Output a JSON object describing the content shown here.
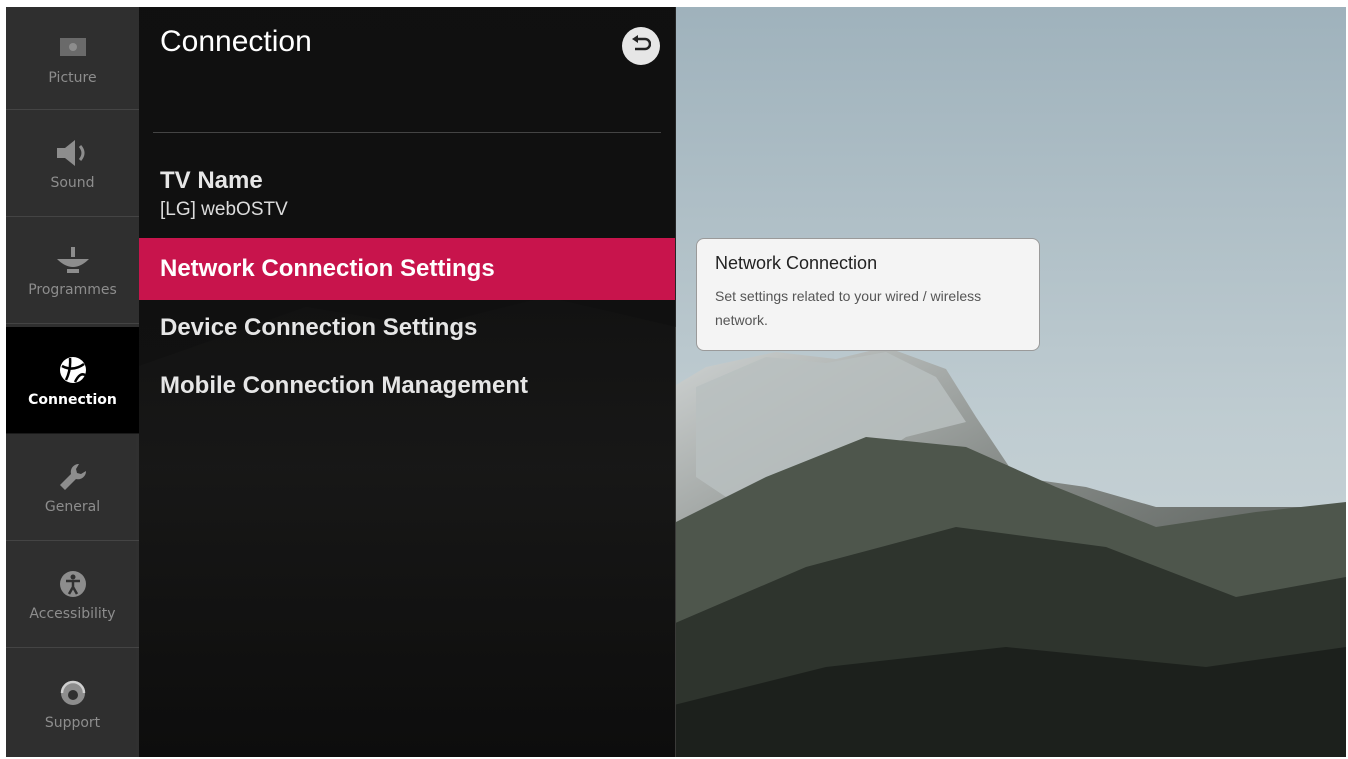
{
  "sidebar": {
    "items": [
      {
        "label": "Picture",
        "icon": "picture-icon",
        "active": false
      },
      {
        "label": "Sound",
        "icon": "speaker-icon",
        "active": false
      },
      {
        "label": "Programmes",
        "icon": "antenna-icon",
        "active": false
      },
      {
        "label": "Connection",
        "icon": "globe-icon",
        "active": true
      },
      {
        "label": "General",
        "icon": "wrench-icon",
        "active": false
      },
      {
        "label": "Accessibility",
        "icon": "accessibility-icon",
        "active": false
      },
      {
        "label": "Support",
        "icon": "support-icon",
        "active": false
      }
    ]
  },
  "panel": {
    "title": "Connection",
    "back_icon": "back-arrow-icon",
    "items": [
      {
        "label": "TV Name",
        "value": "[LG] webOSTV"
      },
      {
        "label": "Network Connection Settings",
        "selected": true
      },
      {
        "label": "Device Connection Settings"
      },
      {
        "label": "Mobile Connection Management"
      }
    ]
  },
  "tooltip": {
    "title": "Network Connection",
    "body": "Set settings related to your wired / wireless network."
  },
  "colors": {
    "accent": "#c8144c",
    "rail_bg": "#303030",
    "active_rail_bg": "#000000"
  }
}
